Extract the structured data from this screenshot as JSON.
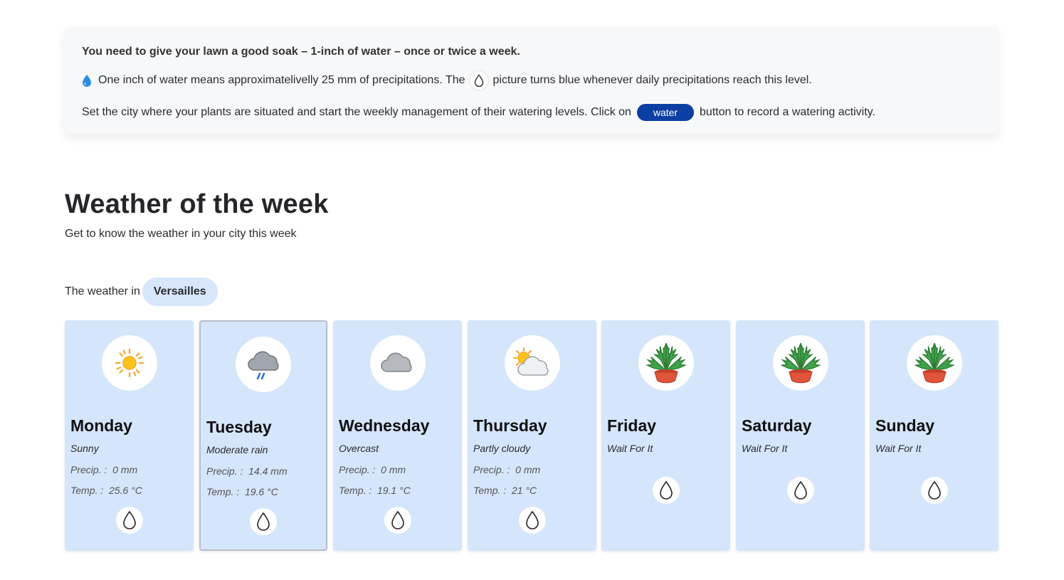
{
  "info": {
    "headline": "You need to give your lawn a good soak – 1-inch of water – once or twice a week.",
    "line2_before": "One inch of water means approximatelivelly 25 mm of precipitations. The",
    "line2_after": "picture turns blue whenever daily precipitations reach this level.",
    "line3_before": "Set the city where your plants are situated and start the weekly management of their watering levels. Click on",
    "water_button_label": "water",
    "line3_after": "button to record a watering activity."
  },
  "weather": {
    "title": "Weather of the week",
    "subtitle": "Get to know the weather in your city this week",
    "city_prefix": "The weather in",
    "city": "Versailles"
  },
  "days": [
    {
      "name": "Monday",
      "condition": "Sunny",
      "icon": "sun-icon",
      "precip_label": "Precip. :",
      "precip": "0 mm",
      "temp_label": "Temp. :",
      "temp": "25.6 °C"
    },
    {
      "name": "Tuesday",
      "condition": "Moderate rain",
      "icon": "rain-cloud-icon",
      "precip_label": "Precip. :",
      "precip": "14.4 mm",
      "temp_label": "Temp. :",
      "temp": "19.6 °C"
    },
    {
      "name": "Wednesday",
      "condition": "Overcast",
      "icon": "cloud-icon",
      "precip_label": "Precip. :",
      "precip": "0 mm",
      "temp_label": "Temp. :",
      "temp": "19.1 °C"
    },
    {
      "name": "Thursday",
      "condition": "Partly cloudy",
      "icon": "partly-cloudy-icon",
      "precip_label": "Precip. :",
      "precip": "0 mm",
      "temp_label": "Temp. :",
      "temp": "21 °C"
    },
    {
      "name": "Friday",
      "condition": "Wait For It",
      "icon": "potted-plant-icon"
    },
    {
      "name": "Saturday",
      "condition": "Wait For It",
      "icon": "potted-plant-icon"
    },
    {
      "name": "Sunday",
      "condition": "Wait For It",
      "icon": "potted-plant-icon"
    }
  ],
  "colors": {
    "card_bg": "#d5e5fb",
    "city_pill_bg": "#d7e6fb",
    "water_button_bg": "#0b3fa3",
    "drop_emoji": "#2a8fe0"
  }
}
